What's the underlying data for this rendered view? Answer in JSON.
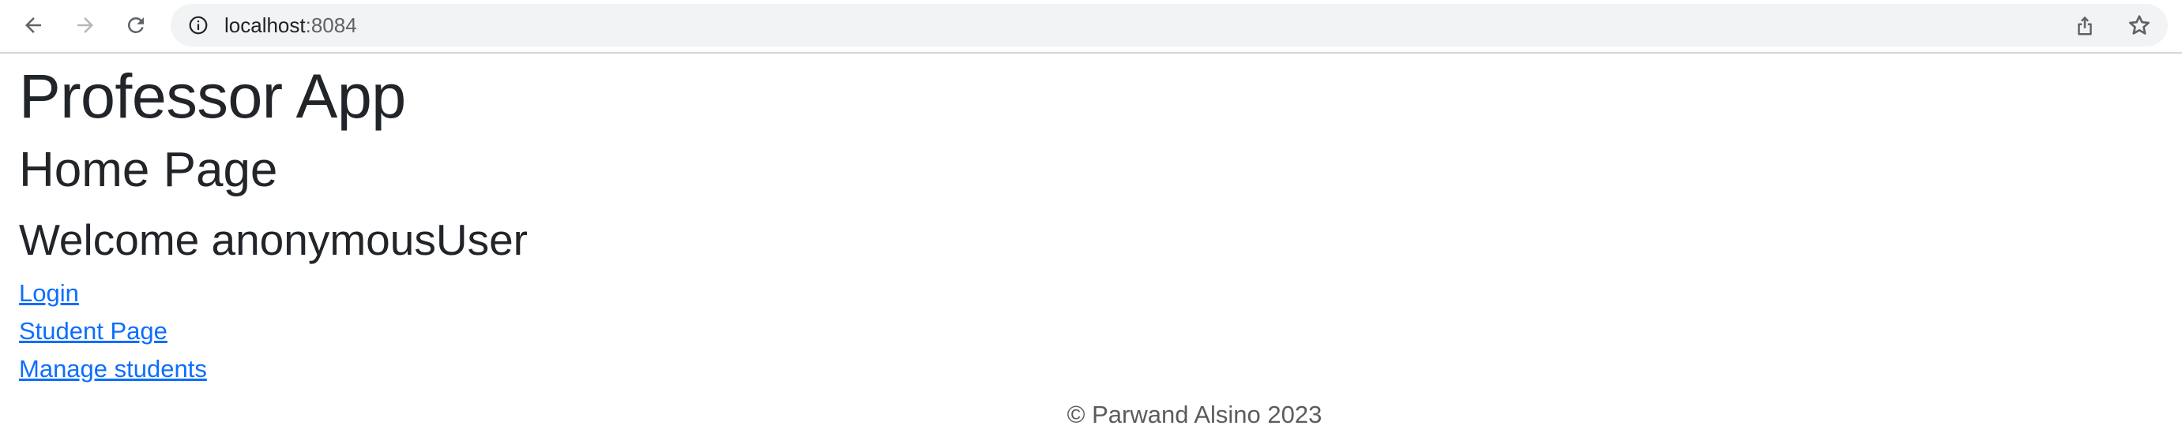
{
  "browser": {
    "url_host": "localhost",
    "url_port": ":8084",
    "icons": {
      "back": "arrow-left",
      "forward": "arrow-right",
      "reload": "reload",
      "info": "info-circle",
      "share": "share",
      "bookmark": "star"
    }
  },
  "page": {
    "app_title": "Professor App",
    "page_title": "Home Page",
    "welcome": "Welcome anonymousUser",
    "links": [
      {
        "label": "Login"
      },
      {
        "label": "Student Page"
      },
      {
        "label": "Manage students"
      }
    ],
    "footer": "© Parwand Alsino 2023"
  },
  "colors": {
    "link": "#0d6efd",
    "text": "#212529",
    "footer_text": "#595c5f",
    "omnibox_bg": "#f1f3f4"
  }
}
